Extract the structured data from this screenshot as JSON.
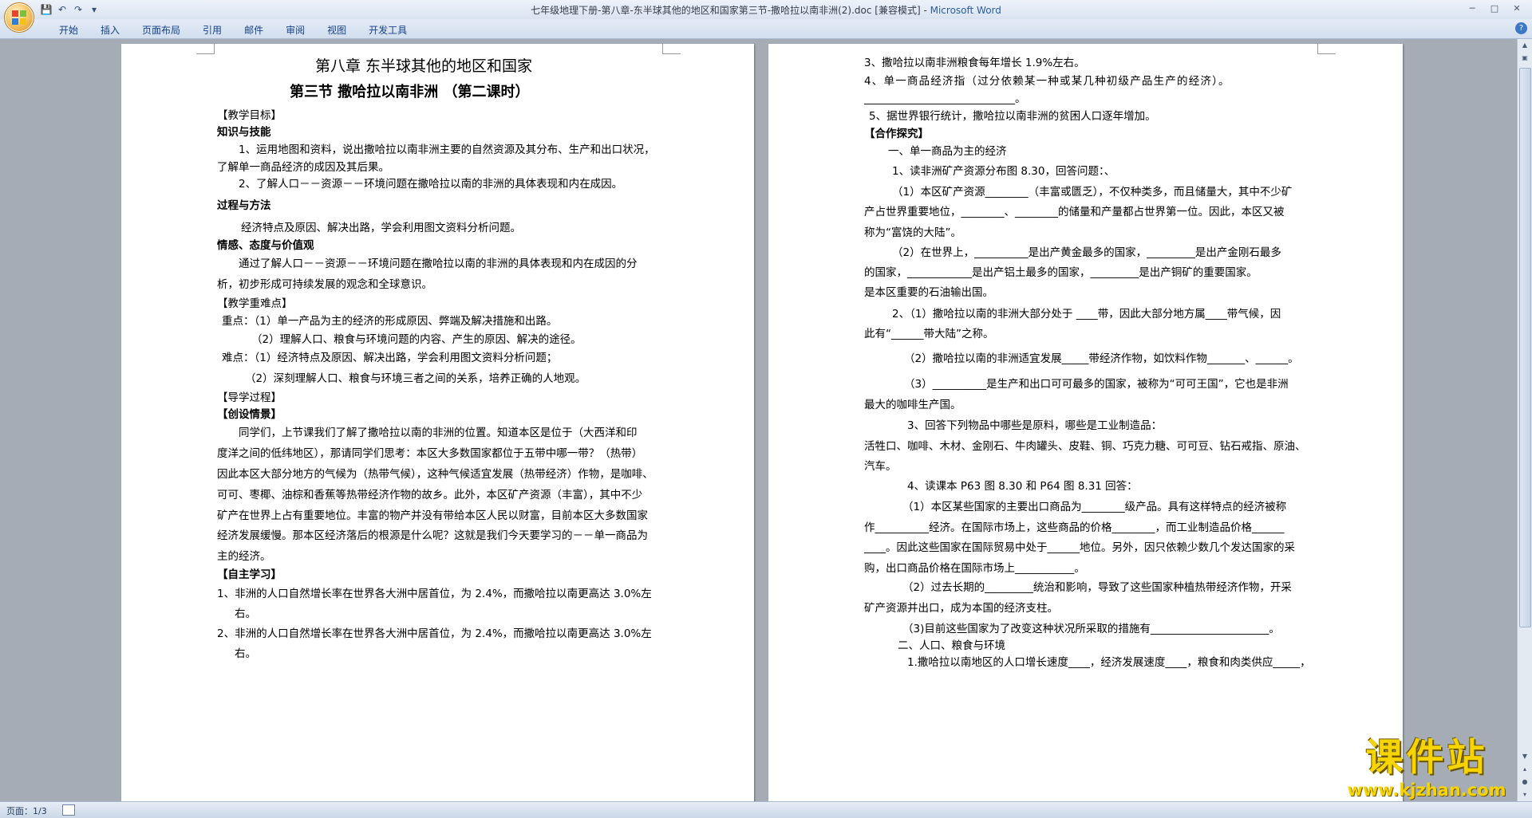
{
  "window": {
    "title": "七年级地理下册-第八章-东半球其他的地区和国家第三节-撒哈拉以南非洲(2).doc [兼容模式] - ",
    "app_name": "Microsoft Word"
  },
  "qat": {
    "save_icon": "floppy-disk-icon",
    "undo_icon": "undo-icon",
    "redo_icon": "redo-icon",
    "customize_icon": "dropdown-arrow-icon"
  },
  "ribbon": {
    "tabs": [
      {
        "label": "开始"
      },
      {
        "label": "插入"
      },
      {
        "label": "页面布局"
      },
      {
        "label": "引用"
      },
      {
        "label": "邮件"
      },
      {
        "label": "审阅"
      },
      {
        "label": "视图"
      },
      {
        "label": "开发工具"
      }
    ],
    "help": "?"
  },
  "page_left": {
    "lines": [
      "第八章  东半球其他的地区和国家",
      "第三节  撒哈拉以南非洲  （第二课时）",
      "【教学目标】",
      "知识与技能",
      "1、运用地图和资料，说出撒哈拉以南非洲主要的自然资源及其分布、生产和出口状况，",
      "了解单一商品经济的成因及其后果。",
      "2、了解人口－－资源－－环境问题在撒哈拉以南的非洲的具体表现和内在成因。",
      "过程与方法",
      "经济特点及原因、解决出路，学会利用图文资料分析问题。",
      "情感、态度与价值观",
      "通过了解人口－－资源－－环境问题在撒哈拉以南的非洲的具体表现和内在成因的分",
      "析，初步形成可持续发展的观念和全球意识。",
      "【教学重难点】",
      "重点：（1）单一产品为主的经济的形成原因、弊端及解决措施和出路。",
      "（2）理解人口、粮食与环境问题的内容、产生的原因、解决的途径。",
      "难点：（1）经济特点及原因、解决出路，学会利用图文资料分析问题；",
      "（2）深刻理解人口、粮食与环境三者之间的关系，培养正确的人地观。",
      "【导学过程】",
      "【创设情景】",
      "同学们，上节课我们了解了撒哈拉以南的非洲的位置。知道本区是位于（大西洋和印",
      "度洋之间的低纬地区），那请同学们思考：本区大多数国家都位于五带中哪一带？（热带）",
      "因此本区大部分地方的气候为（热带气候），这种气候适宜发展（热带经济）作物，是咖啡、",
      "可可、枣椰、油棕和香蕉等热带经济作物的故乡。此外，本区矿产资源（丰富），其中不少",
      "矿产在世界上占有重要地位。丰富的物产并没有带给本区人民以财富，目前本区大多数国家",
      "经济发展缓慢。那本区经济落后的根源是什么呢？这就是我们今天要学习的－－单一商品为",
      "主的经济。",
      "【自主学习】",
      "1、非洲的人口自然增长率在世界各大洲中居首位，为 2.4%，而撒哈拉以南更高达 3.0%左",
      "右。",
      "2、非洲的人口自然增长率在世界各大洲中居首位，为 2.4%，而撒哈拉以南更高达 3.0%左",
      "右。"
    ]
  },
  "page_right": {
    "lines": [
      "3、撒哈拉以南非洲粮食每年增长 1.9%左右。",
      "4、单一商品经济指（过分依赖某一种或某几种初级产品生产的经济）。",
      "____________________________。",
      "5、据世界银行统计，撒哈拉以南非洲的贫困人口逐年增加。",
      "【合作探究】",
      "一、单一商品为主的经济",
      "1、读非洲矿产资源分布图 8.30，回答问题：、",
      "（1）本区矿产资源________（丰富或匮乏），不仅种类多，而且储量大，其中不少矿",
      "产占世界重要地位，________、________的储量和产量都占世界第一位。因此，本区又被",
      "称为“富饶的大陆”。",
      "（2）在世界上，__________是出产黄金最多的国家，_________是出产金刚石最多",
      "的国家，____________是出产铝土最多的国家，_________是出产铜矿的重要国家。",
      "是本区重要的石油输出国。",
      "2、（1）撒哈拉以南的非洲大部分处于 ____带，因此大部分地方属____带气候，因",
      "此有“______带大陆”之称。",
      "（2）撒哈拉以南的非洲适宜发展_____带经济作物，如饮料作物_______、______。",
      "（3）__________是生产和出口可可最多的国家，被称为“可可王国”，它也是非洲",
      "最大的咖啡生产国。",
      "3、回答下列物品中哪些是原料，哪些是工业制造品：",
      "活牲口、咖啡、木材、金刚石、牛肉罐头、皮鞋、铜、巧克力糖、可可豆、钻石戒指、原油、",
      "汽车。",
      "4、读课本 P63 图 8.30 和 P64 图 8.31 回答：",
      "（1）本区某些国家的主要出口商品为________级产品。具有这样特点的经济被称",
      "作__________经济。在国际市场上，这些商品的价格________，而工业制造品价格______",
      "____。因此这些国家在国际贸易中处于______地位。另外，因只依赖少数几个发达国家的采",
      "购，出口商品价格在国际市场上___________。",
      "（2）过去长期的_________统治和影响，导致了这些国家种植热带经济作物，开采",
      "矿产资源并出口，成为本国的经济支柱。",
      "（3)目前这些国家为了改变这种状况所采取的措施有______________________。",
      "二、人口、粮食与环境",
      "1.撒哈拉以南地区的人口增长速度____，经济发展速度____，粮食和肉类供应_____，"
    ]
  },
  "statusbar": {
    "page_count": "页面：1/3"
  },
  "watermark": {
    "title": "课件站",
    "url": "www.kjzhan.com"
  }
}
